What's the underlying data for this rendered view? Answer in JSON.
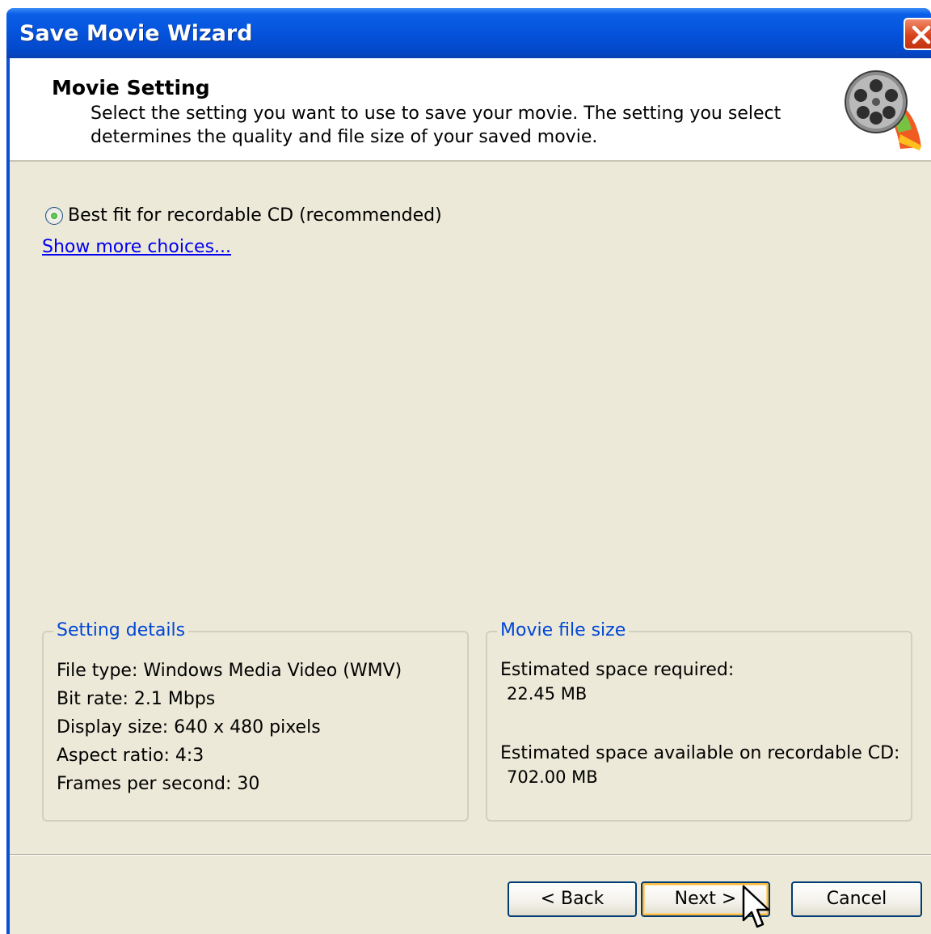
{
  "window": {
    "title": "Save Movie Wizard"
  },
  "header": {
    "title": "Movie Setting",
    "description": "Select the setting you want to use to save your movie. The setting you select determines the quality and file size of your saved movie."
  },
  "option": {
    "label": "Best fit for recordable CD (recommended)",
    "selected": true
  },
  "more_link": "Show more choices...",
  "setting_details": {
    "title": "Setting details",
    "lines": [
      "File type: Windows Media Video (WMV)",
      "Bit rate: 2.1 Mbps",
      "Display size: 640 x 480 pixels",
      "Aspect ratio: 4:3",
      "Frames per second: 30"
    ]
  },
  "file_size": {
    "title": "Movie file size",
    "required_label": "Estimated space required:",
    "required_value": "22.45 MB",
    "available_label": "Estimated space available on recordable CD:",
    "available_value": "702.00 MB"
  },
  "buttons": {
    "back": "< Back",
    "next": "Next >",
    "cancel": "Cancel"
  },
  "colors": {
    "title_bar": "#0553dc",
    "dialog_bg": "#ece9d8",
    "link": "#0000ee",
    "group_title": "#0046d5"
  }
}
